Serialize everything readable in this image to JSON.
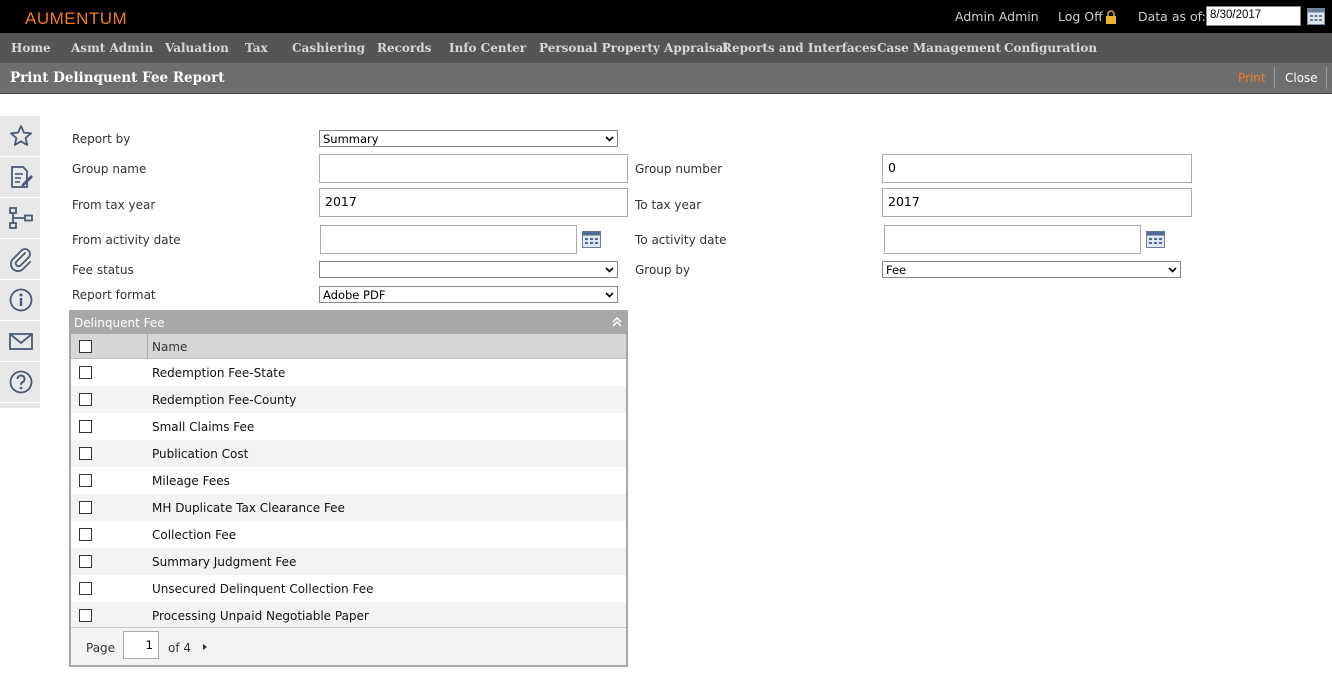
{
  "app": {
    "logo": "AUMENTUM",
    "user": "Admin Admin",
    "logoff": "Log Off",
    "data_as_of_label": "Data as of:",
    "data_as_of_value": "8/30/2017"
  },
  "nav": {
    "items": [
      {
        "label": "Home"
      },
      {
        "label": "Asmt Admin"
      },
      {
        "label": "Valuation"
      },
      {
        "label": "Tax"
      },
      {
        "label": "Cashiering"
      },
      {
        "label": "Records"
      },
      {
        "label": "Info Center"
      },
      {
        "label": "Personal Property Appraisal"
      },
      {
        "label": "Reports and Interfaces"
      },
      {
        "label": "Case Management"
      },
      {
        "label": "Configuration"
      }
    ]
  },
  "page": {
    "title": "Print Delinquent Fee Report",
    "print_label": "Print",
    "close_label": "Close"
  },
  "sidebar": {
    "icons": [
      "star-icon",
      "edit-document-icon",
      "hierarchy-icon",
      "paperclip-icon",
      "info-icon",
      "mail-icon",
      "help-icon"
    ]
  },
  "form": {
    "report_by": {
      "label": "Report by",
      "value": "Summary"
    },
    "group_name": {
      "label": "Group name",
      "value": ""
    },
    "group_number": {
      "label": "Group number",
      "value": "0"
    },
    "from_tax_year": {
      "label": "From tax year",
      "value": "2017"
    },
    "to_tax_year": {
      "label": "To tax year",
      "value": "2017"
    },
    "from_activity_date": {
      "label": "From activity date",
      "value": ""
    },
    "to_activity_date": {
      "label": "To activity date",
      "value": ""
    },
    "fee_status": {
      "label": "Fee status",
      "value": ""
    },
    "group_by": {
      "label": "Group by",
      "value": "Fee"
    },
    "report_format": {
      "label": "Report format",
      "value": "Adobe PDF"
    }
  },
  "grid": {
    "title": "Delinquent Fee",
    "column_name": "Name",
    "rows": [
      {
        "name": "Redemption Fee-State",
        "checked": false
      },
      {
        "name": "Redemption Fee-County",
        "checked": false
      },
      {
        "name": "Small Claims Fee",
        "checked": false
      },
      {
        "name": "Publication Cost",
        "checked": false
      },
      {
        "name": "Mileage Fees",
        "checked": false
      },
      {
        "name": "MH Duplicate Tax Clearance Fee",
        "checked": false
      },
      {
        "name": "Collection Fee",
        "checked": false
      },
      {
        "name": "Summary Judgment Fee",
        "checked": false
      },
      {
        "name": "Unsecured Delinquent Collection Fee",
        "checked": false
      },
      {
        "name": "Processing Unpaid Negotiable Paper",
        "checked": false
      }
    ],
    "pager": {
      "page_label": "Page",
      "page": "1",
      "of_label": "of 4"
    }
  },
  "colors": {
    "accent": "#f47b20",
    "topbar": "#000000",
    "nav": "#555555",
    "header": "#6e6e6e"
  }
}
